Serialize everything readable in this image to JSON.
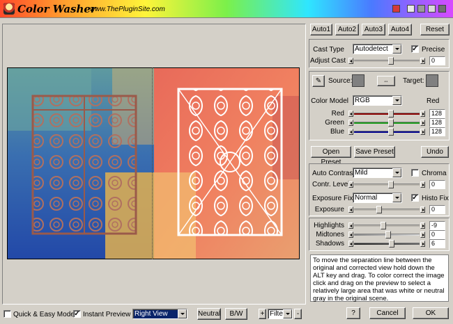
{
  "app": {
    "title": "Color Washer",
    "url": "www.ThePluginSite.com"
  },
  "auto_buttons": [
    "Auto1",
    "Auto2",
    "Auto3",
    "Auto4"
  ],
  "reset_label": "Reset",
  "cast": {
    "type_label": "Cast Type",
    "type_value": "Autodetect",
    "precise_label": "Precise",
    "precise_checked": true,
    "adjust_label": "Adjust Cast",
    "adjust_value": "0",
    "adjust_level": 0.5
  },
  "source_label": "Source:",
  "target_label": "Target:",
  "color_model": {
    "label": "Color Model",
    "value": "RGB",
    "channel_label": "Red"
  },
  "rgb": [
    {
      "label": "Red",
      "value": "128",
      "level": 0.5,
      "color": "#8b0000"
    },
    {
      "label": "Green",
      "value": "128",
      "level": 0.5,
      "color": "#1a9a1a"
    },
    {
      "label": "Blue",
      "value": "128",
      "level": 0.5,
      "color": "#00008b"
    }
  ],
  "preset": {
    "open": "Open Preset",
    "save": "Save Preset",
    "undo": "Undo"
  },
  "contrast": {
    "auto_label": "Auto Contrast",
    "auto_value": "Mild",
    "chroma_label": "Chroma",
    "chroma_checked": false,
    "level_label": "Contr. Level",
    "level_value": "0",
    "level": 0.5
  },
  "exposure": {
    "fix_label": "Exposure Fix",
    "fix_value": "Normal",
    "histo_label": "Histo Fix",
    "histo_checked": true,
    "label": "Exposure",
    "value": "0",
    "level": 0.35
  },
  "tones": [
    {
      "label": "Highlights",
      "value": "-9",
      "level": 0.42
    },
    {
      "label": "Midtones",
      "value": "0",
      "level": 0.5
    },
    {
      "label": "Shadows",
      "value": "6",
      "level": 0.55
    }
  ],
  "help_text": "To move the separation line between the original and corrected view hold down the ALT key and drag. To color correct the image click and drag on the preview to select a relatively large area that was white or neutral gray in the original scene.",
  "bottom": {
    "quick_label": "Quick & Easy Mode",
    "quick_checked": false,
    "instant_label": "Instant Preview",
    "instant_checked": true,
    "view_value": "Right View",
    "neutral": "Neutral",
    "bw": "B/W",
    "plus": "+",
    "filter_value": "Filter",
    "minus": "-",
    "help_btn": "?",
    "cancel": "Cancel",
    "ok": "OK"
  },
  "colors": {
    "titlebar_accent": "#ff9d2e",
    "selection_blue": "#0a246a",
    "neutral_gray": "#808080"
  }
}
